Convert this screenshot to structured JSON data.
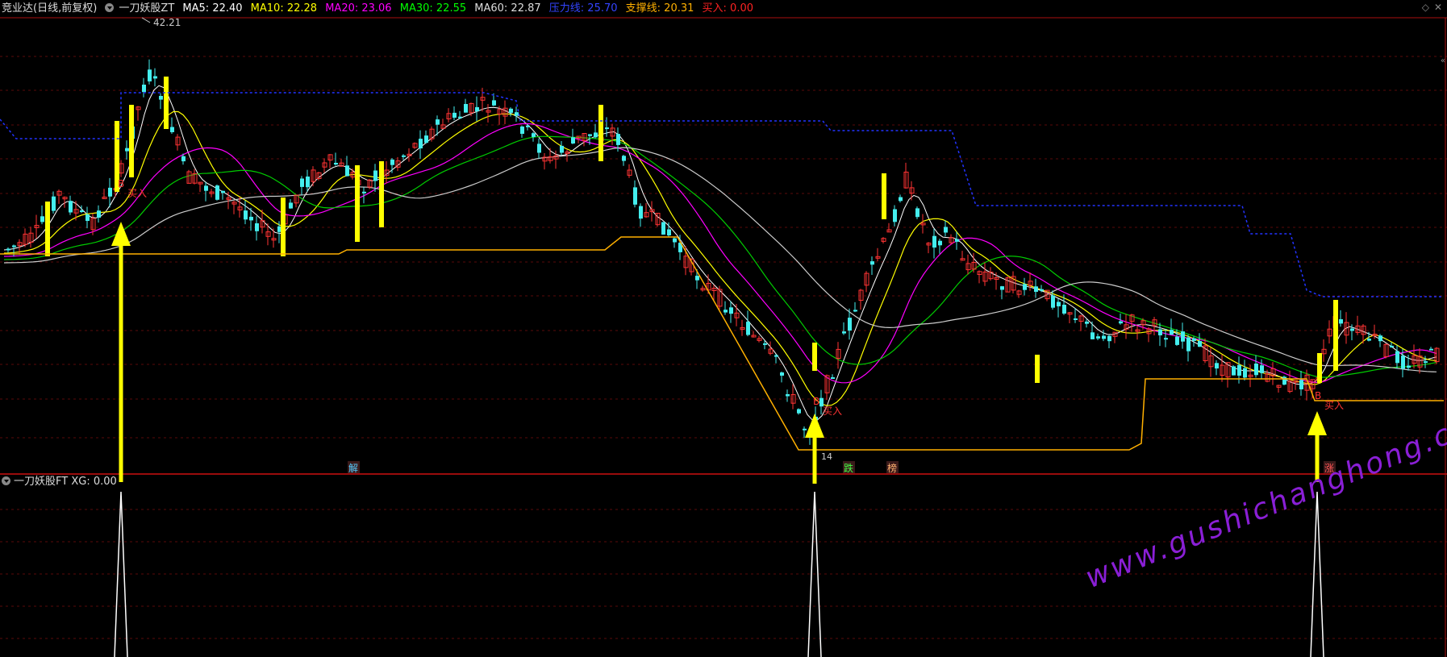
{
  "header": {
    "stock": "竞业达(日线,前复权)",
    "indicator": "一刀妖股ZT",
    "items": [
      {
        "label": "MA5: 22.40",
        "color": "#ffffff"
      },
      {
        "label": "MA10: 22.28",
        "color": "#ffff00"
      },
      {
        "label": "MA20: 23.06",
        "color": "#ff00ff"
      },
      {
        "label": "MA30: 22.55",
        "color": "#00ff00"
      },
      {
        "label": "MA60: 22.87",
        "color": "#dddddd"
      },
      {
        "label": "压力线: 25.70",
        "color": "#3344ff"
      },
      {
        "label": "支撑线: 20.31",
        "color": "#ffb000"
      },
      {
        "label": "买入: 0.00",
        "color": "#ff2222"
      }
    ]
  },
  "subheader": {
    "indicator": "一刀妖股FT",
    "value": "XG: 0.00"
  },
  "annotations": {
    "high_label": "42.21",
    "low_label": "14",
    "buy_label": "买入",
    "buy_marker": "B",
    "tags": [
      {
        "text": "解",
        "color": "#55ccff"
      },
      {
        "text": "跌",
        "color": "#44ff44"
      },
      {
        "text": "榜",
        "color": "#ffb070"
      },
      {
        "text": "涨",
        "color": "#ff5555"
      }
    ]
  },
  "watermark": "www.gushichanghong.com",
  "chart_data": {
    "type": "candlestick",
    "high": 42.21,
    "low_label": "14",
    "moving_averages": [
      "MA5",
      "MA10",
      "MA20",
      "MA30",
      "MA60"
    ],
    "resistance": 25.7,
    "support": 20.31,
    "buy_signals": 3,
    "sub_indicator": {
      "name": "一刀妖股FT",
      "series": "XG",
      "value": 0.0,
      "spikes": 3
    }
  }
}
